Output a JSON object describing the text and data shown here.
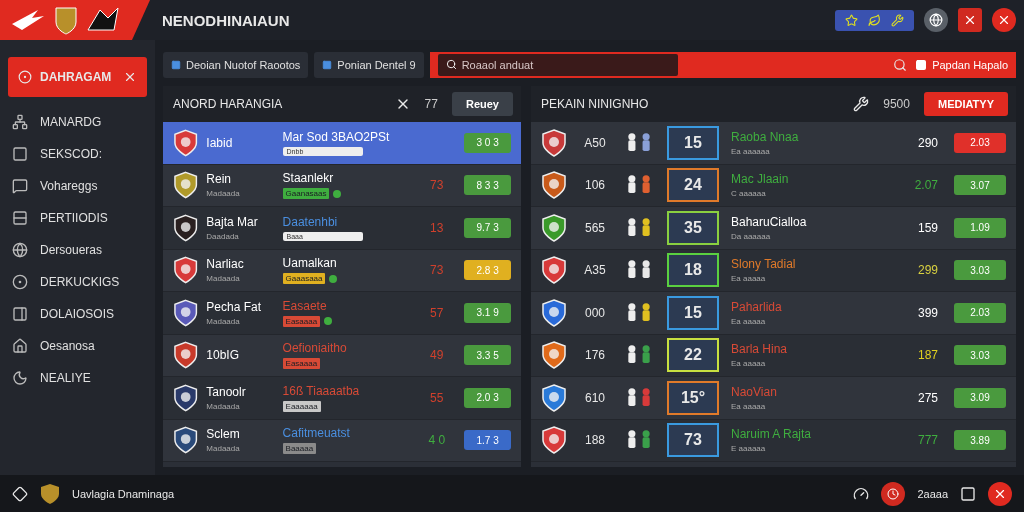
{
  "header": {
    "title": "NENODHINAIAUN"
  },
  "toolbar": {
    "buttons": [
      "Deoian Nuotof Raootos",
      "Ponian Dentel 9"
    ],
    "search": {
      "placeholder": "Roaaol anduat"
    },
    "action": "Papdan Hapalo"
  },
  "sidebar": {
    "active": "DAHRAGAM",
    "items": [
      {
        "label": "MANARDG",
        "kind": "network"
      },
      {
        "label": "SEKSCOD:",
        "kind": "square"
      },
      {
        "label": "Vohareggs",
        "kind": "chat"
      },
      {
        "label": "PERTIIODIS",
        "kind": "rows"
      },
      {
        "label": "Dersoueras",
        "kind": "globe"
      },
      {
        "label": "DERKUCKIGS",
        "kind": "target"
      },
      {
        "label": "DOLAIOSOIS",
        "kind": "panel"
      },
      {
        "label": "Oesanosa",
        "kind": "home"
      },
      {
        "label": "NEALIYE",
        "kind": "moon"
      }
    ]
  },
  "left_panel": {
    "title": "ANORD HARANGIA",
    "count": "77",
    "button": "Reuey",
    "rows": [
      {
        "selected": true,
        "badge": {
          "color": "#d83a3a"
        },
        "name": "Iabid",
        "title": {
          "text": "Mar Sod 3BAO2PSt",
          "color": "#ffffff"
        },
        "note": {
          "text": "Dnbb",
          "kind": "chip",
          "dot": false
        },
        "odds": {
          "text": "3 0 3",
          "color": "#4a9a3e"
        }
      },
      {
        "selected": false,
        "badge": {
          "color": "#b09a2a"
        },
        "name": "Rein",
        "sub": "Madaada",
        "title": {
          "text": "Staanlekr",
          "color": "#ffffff"
        },
        "note": {
          "text": "Gaanasaas",
          "kind": "text",
          "color": "#3fae3f",
          "dot": true
        },
        "score": {
          "text": "73",
          "color": "#d0402c"
        },
        "odds": {
          "text": "8 3 3",
          "color": "#4a9a3e"
        }
      },
      {
        "selected": false,
        "badge": {
          "color": "#2a2020"
        },
        "name": "Bajta Mar",
        "sub": "Daadada",
        "title": {
          "text": "Daatenhbi",
          "color": "#4a8fe0"
        },
        "note": {
          "text": "Baaa",
          "kind": "chip",
          "dot": false
        },
        "score": {
          "text": "13",
          "color": "#d0402c"
        },
        "odds": {
          "text": "9.7 3",
          "color": "#4a9a3e"
        }
      },
      {
        "selected": false,
        "badge": {
          "color": "#d83a3a"
        },
        "name": "Narliac",
        "sub": "Madaada",
        "title": {
          "text": "Uamalkan",
          "color": "#ffffff"
        },
        "note": {
          "text": "Gaaasaaa",
          "kind": "text",
          "color": "#e0b020",
          "dot": true
        },
        "score": {
          "text": "73",
          "color": "#d0402c"
        },
        "odds": {
          "text": "2.8 3",
          "color": "#e0b020"
        }
      },
      {
        "selected": false,
        "badge": {
          "color": "#5a5ab8"
        },
        "name": "Pecha Fat",
        "sub": "Madaada",
        "title": {
          "text": "Easaete",
          "color": "#d84a36"
        },
        "note": {
          "text": "Easaaaa",
          "kind": "text",
          "color": "#d84a36",
          "dot": true
        },
        "score": {
          "text": "57",
          "color": "#d0402c"
        },
        "odds": {
          "text": "3.1 9",
          "color": "#4a9a3e"
        }
      },
      {
        "selected": false,
        "badge": {
          "color": "#c83a2a"
        },
        "name": "10bIG",
        "title": {
          "text": "Oefioniaitho",
          "color": "#d84a36"
        },
        "note": {
          "text": "Easaaaa",
          "kind": "text",
          "color": "#d84a36",
          "dot": false
        },
        "score": {
          "text": "49",
          "color": "#d0402c"
        },
        "odds": {
          "text": "3.3 5",
          "color": "#4a9a3e"
        }
      },
      {
        "selected": false,
        "badge": {
          "color": "#2a3a6a"
        },
        "name": "Tanoolr",
        "sub": "Madaada",
        "title": {
          "text": "16ß Tiaaaatba",
          "color": "#d84a36"
        },
        "note": {
          "text": "Eaaaaaa",
          "kind": "text",
          "color": "#c8c8c8",
          "dot": false
        },
        "score": {
          "text": "55",
          "color": "#d0402c"
        },
        "odds": {
          "text": "2.0 3",
          "color": "#4a9a3e"
        }
      },
      {
        "selected": false,
        "badge": {
          "color": "#2a4a7a"
        },
        "name": "Sclem",
        "sub": "Madaada",
        "title": {
          "text": "Cafitmeuatst",
          "color": "#4a8fe0"
        },
        "note": {
          "text": "Baaaaa",
          "kind": "text",
          "color": "#8a8a8a",
          "dot": false
        },
        "score": {
          "text": "4 0",
          "color": "#3fae3f"
        },
        "odds": {
          "text": "1.7 3",
          "color": "#3a6ac8"
        }
      }
    ]
  },
  "right_panel": {
    "title": "PEKAIN NINIGNHO",
    "count": "9500",
    "button": "MEDIATYY",
    "rows": [
      {
        "badge": {
          "color": "#c83a3a"
        },
        "number": "A50",
        "emblem": {
          "color": "#8aa0d8"
        },
        "score": {
          "text": "15",
          "color": "#3a9ae0"
        },
        "name": {
          "text": "Raoba Nnaa",
          "color": "#3fae3f"
        },
        "sub": "Ea aaaaaa",
        "value": {
          "text": "290",
          "color": "#ffffff"
        },
        "odds": {
          "text": "2.03",
          "color": "#e0302a"
        }
      },
      {
        "badge": {
          "color": "#c85a1a"
        },
        "number": "106",
        "emblem": {
          "color": "#e06030"
        },
        "score": {
          "text": "24",
          "color": "#e07a2a"
        },
        "name": {
          "text": "Mac Jlaain",
          "color": "#3fae3f"
        },
        "sub": "C aaaaaa",
        "value": {
          "text": "2.07",
          "color": "#3fae3f"
        },
        "odds": {
          "text": "3.07",
          "color": "#4a9a3e"
        }
      },
      {
        "badge": {
          "color": "#3a9a2a"
        },
        "number": "565",
        "emblem": {
          "color": "#e0c020"
        },
        "score": {
          "text": "35",
          "color": "#8ad040"
        },
        "name": {
          "text": "BaharuCialloa",
          "color": "#ffffff"
        },
        "sub": "Da aaaaaa",
        "value": {
          "text": "159",
          "color": "#ffffff"
        },
        "odds": {
          "text": "1.09",
          "color": "#4a9a3e"
        }
      },
      {
        "badge": {
          "color": "#d83a3a"
        },
        "number": "A35",
        "emblem": {
          "color": "#e8e8e8"
        },
        "score": {
          "text": "18",
          "color": "#5ad040"
        },
        "name": {
          "text": "Slony Tadial",
          "color": "#e07a2a"
        },
        "sub": "Ea aaaaa",
        "value": {
          "text": "299",
          "color": "#d8d040"
        },
        "odds": {
          "text": "3.03",
          "color": "#4a9a3e"
        }
      },
      {
        "badge": {
          "color": "#2a6ad8"
        },
        "number": "000",
        "emblem": {
          "color": "#e0c020"
        },
        "score": {
          "text": "15",
          "color": "#3a9ae0"
        },
        "name": {
          "text": "Paharlida",
          "color": "#d84a36"
        },
        "sub": "Ea aaaaa",
        "value": {
          "text": "399",
          "color": "#ffffff"
        },
        "odds": {
          "text": "2.03",
          "color": "#4a9a3e"
        }
      },
      {
        "badge": {
          "color": "#e06a1a"
        },
        "number": "176",
        "emblem": {
          "color": "#3aa04a"
        },
        "score": {
          "text": "22",
          "color": "#c8e040"
        },
        "name": {
          "text": "Barla Hina",
          "color": "#d84a36"
        },
        "sub": "Ea aaaaa",
        "value": {
          "text": "187",
          "color": "#e0d020"
        },
        "odds": {
          "text": "3.03",
          "color": "#4a9a3e"
        }
      },
      {
        "badge": {
          "color": "#2a7ad8"
        },
        "number": "610",
        "emblem": {
          "color": "#d83a3a"
        },
        "score": {
          "text": "15°",
          "color": "#e07a2a"
        },
        "name": {
          "text": "NaoVian",
          "color": "#d84a36"
        },
        "sub": "Ea aaaaa",
        "value": {
          "text": "275",
          "color": "#ffffff"
        },
        "odds": {
          "text": "3.09",
          "color": "#4a9a3e"
        }
      },
      {
        "badge": {
          "color": "#d83a3a"
        },
        "number": "188",
        "emblem": {
          "color": "#3aa04a"
        },
        "score": {
          "text": "73",
          "color": "#3a9ae0"
        },
        "name": {
          "text": "Naruim A Rajta",
          "color": "#3fae3f"
        },
        "sub": "E aaaaaa",
        "value": {
          "text": "777",
          "color": "#3fae3f"
        },
        "odds": {
          "text": "3.89",
          "color": "#4a9a3e"
        }
      }
    ]
  },
  "footer": {
    "label": "Uavlagia Dnaminaga",
    "status": "2aaaa"
  }
}
